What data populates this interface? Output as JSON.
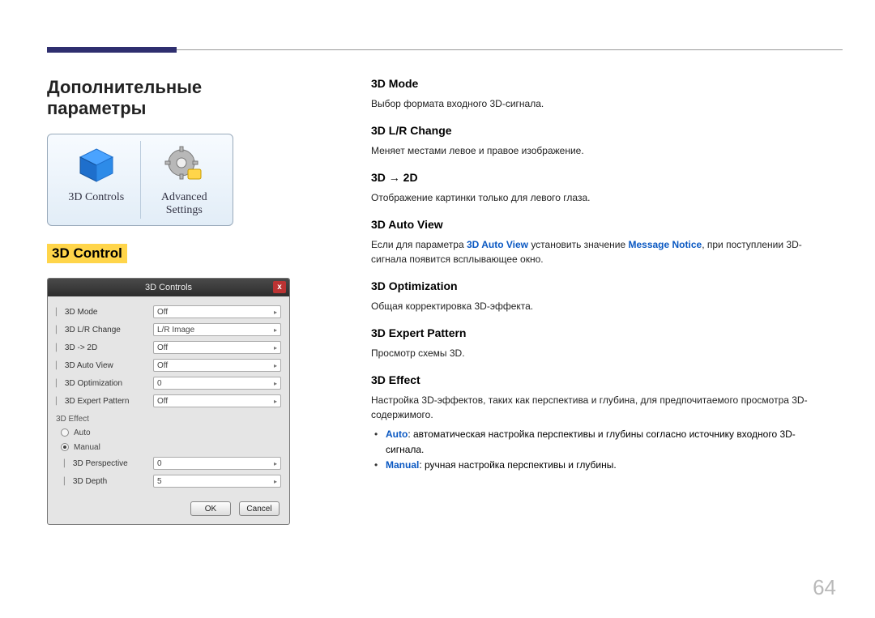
{
  "header": {},
  "page_number": "64",
  "left": {
    "title": "Дополнительные параметры",
    "thumb": {
      "left_label": "3D Controls",
      "right_label": "Advanced Settings"
    },
    "section_heading": "3D Control",
    "dialog": {
      "title": "3D Controls",
      "close": "x",
      "rows": [
        {
          "label": "3D Mode",
          "value": "Off"
        },
        {
          "label": "3D L/R Change",
          "value": "L/R Image"
        },
        {
          "label": "3D -> 2D",
          "value": "Off"
        },
        {
          "label": "3D Auto View",
          "value": "Off"
        },
        {
          "label": "3D Optimization",
          "value": "0"
        },
        {
          "label": "3D Expert Pattern",
          "value": "Off"
        }
      ],
      "effect_label": "3D Effect",
      "radios": [
        {
          "label": "Auto",
          "selected": false
        },
        {
          "label": "Manual",
          "selected": true
        }
      ],
      "sub_rows": [
        {
          "label": "3D Perspective",
          "value": "0"
        },
        {
          "label": "3D Depth",
          "value": "5"
        }
      ],
      "ok": "OK",
      "cancel": "Cancel"
    }
  },
  "right": {
    "features": [
      {
        "h": "3D Mode",
        "p": "Выбор формата входного 3D-сигнала."
      },
      {
        "h": "3D L/R Change",
        "p": "Меняет местами левое и правое изображение."
      },
      {
        "h": "3D → 2D",
        "p": "Отображение картинки только для левого глаза."
      },
      {
        "h": "3D Auto View"
      },
      {
        "h": "3D Optimization",
        "p": "Общая корректировка 3D-эффекта."
      },
      {
        "h": "3D Expert Pattern",
        "p": "Просмотр схемы 3D."
      },
      {
        "h": "3D Effect"
      }
    ],
    "autoview": {
      "pre": "Если для параметра ",
      "kw1": "3D Auto View",
      "mid": " установить значение ",
      "kw2": "Message Notice",
      "post": ", при поступлении 3D-сигнала появится всплывающее окно."
    },
    "effect_desc": "Настройка 3D-эффектов, таких как перспектива и глубина, для предпочитаемого просмотра 3D-содержимого.",
    "bullets": {
      "auto_kw": "Auto",
      "auto_txt": ": автоматическая настройка перспективы и глубины согласно источнику входного 3D-сигнала.",
      "manual_kw": "Manual",
      "manual_txt": ": ручная настройка перспективы и глубины."
    }
  }
}
